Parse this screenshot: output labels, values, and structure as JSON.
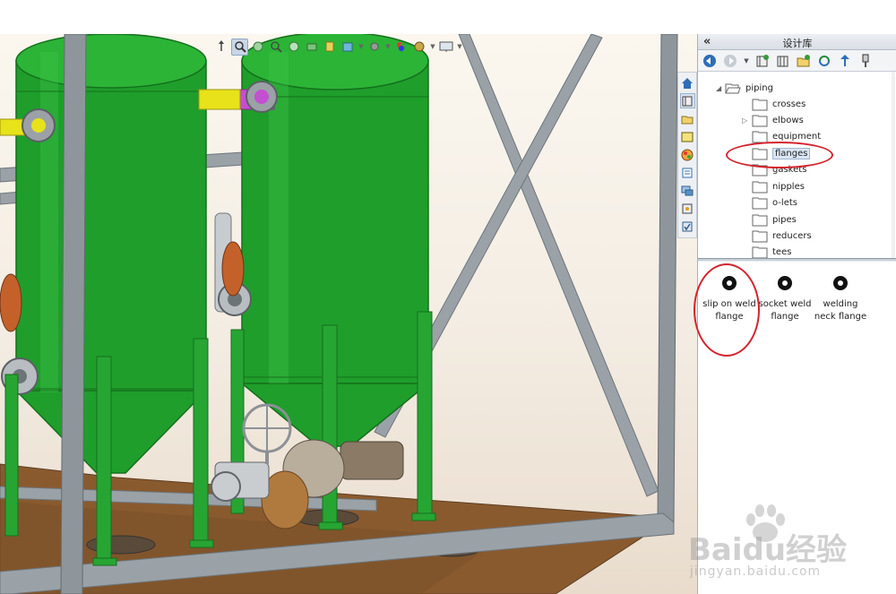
{
  "heads_up_toolbar": {
    "icons": [
      "view-orientation-icon",
      "zoom-area-icon",
      "previous-view-icon",
      "zoom-fit-icon",
      "section-view-icon",
      "dynamic-annotation-icon",
      "view-settings-icon",
      "display-style-icon",
      "hide-show-items-icon",
      "edit-appearance-icon",
      "apply-scene-icon",
      "view-display-icon"
    ]
  },
  "task_pane": {
    "tabs": [
      "home-icon",
      "parts-library-icon",
      "file-explorer-icon",
      "view-palette-icon",
      "appearances-icon",
      "custom-properties-icon",
      "forum-icon",
      "solidworks-resources-icon",
      "design-checker-icon"
    ],
    "active_tab": 1
  },
  "design_library": {
    "title": "设计库",
    "collapse_glyph": "«",
    "toolbar": [
      "back-icon",
      "forward-icon",
      "add-to-library-icon",
      "add-file-location-icon",
      "create-folder-icon",
      "refresh-icon",
      "up-one-level-icon",
      "generate-features-icon"
    ],
    "tree": {
      "root": {
        "label": "piping",
        "expanded": true
      },
      "children": [
        {
          "label": "crosses",
          "expandable": false,
          "selected": false
        },
        {
          "label": "elbows",
          "expandable": true,
          "selected": false
        },
        {
          "label": "equipment",
          "expandable": false,
          "selected": false
        },
        {
          "label": "flanges",
          "expandable": false,
          "selected": true
        },
        {
          "label": "gaskets",
          "expandable": false,
          "selected": false
        },
        {
          "label": "nipples",
          "expandable": false,
          "selected": false
        },
        {
          "label": "o-lets",
          "expandable": false,
          "selected": false
        },
        {
          "label": "pipes",
          "expandable": false,
          "selected": false
        },
        {
          "label": "reducers",
          "expandable": false,
          "selected": false
        },
        {
          "label": "tees",
          "expandable": false,
          "selected": false
        }
      ]
    },
    "palette_items": [
      {
        "line1": "slip on weld",
        "line2": "flange"
      },
      {
        "line1": "socket weld",
        "line2": "flange"
      },
      {
        "line1": "welding",
        "line2": "neck flange"
      }
    ]
  },
  "colors": {
    "vessel_green": "#1f9e2b",
    "frame_gray": "#8e969c",
    "pipe_magenta": "#c44fd0",
    "pipe_yellow": "#e8e21a",
    "floor_brown": "#8a5a2f",
    "annotation_red": "#d4232c"
  },
  "watermark": {
    "brand": "Baidu经验",
    "url": "jingyan.baidu.com"
  }
}
